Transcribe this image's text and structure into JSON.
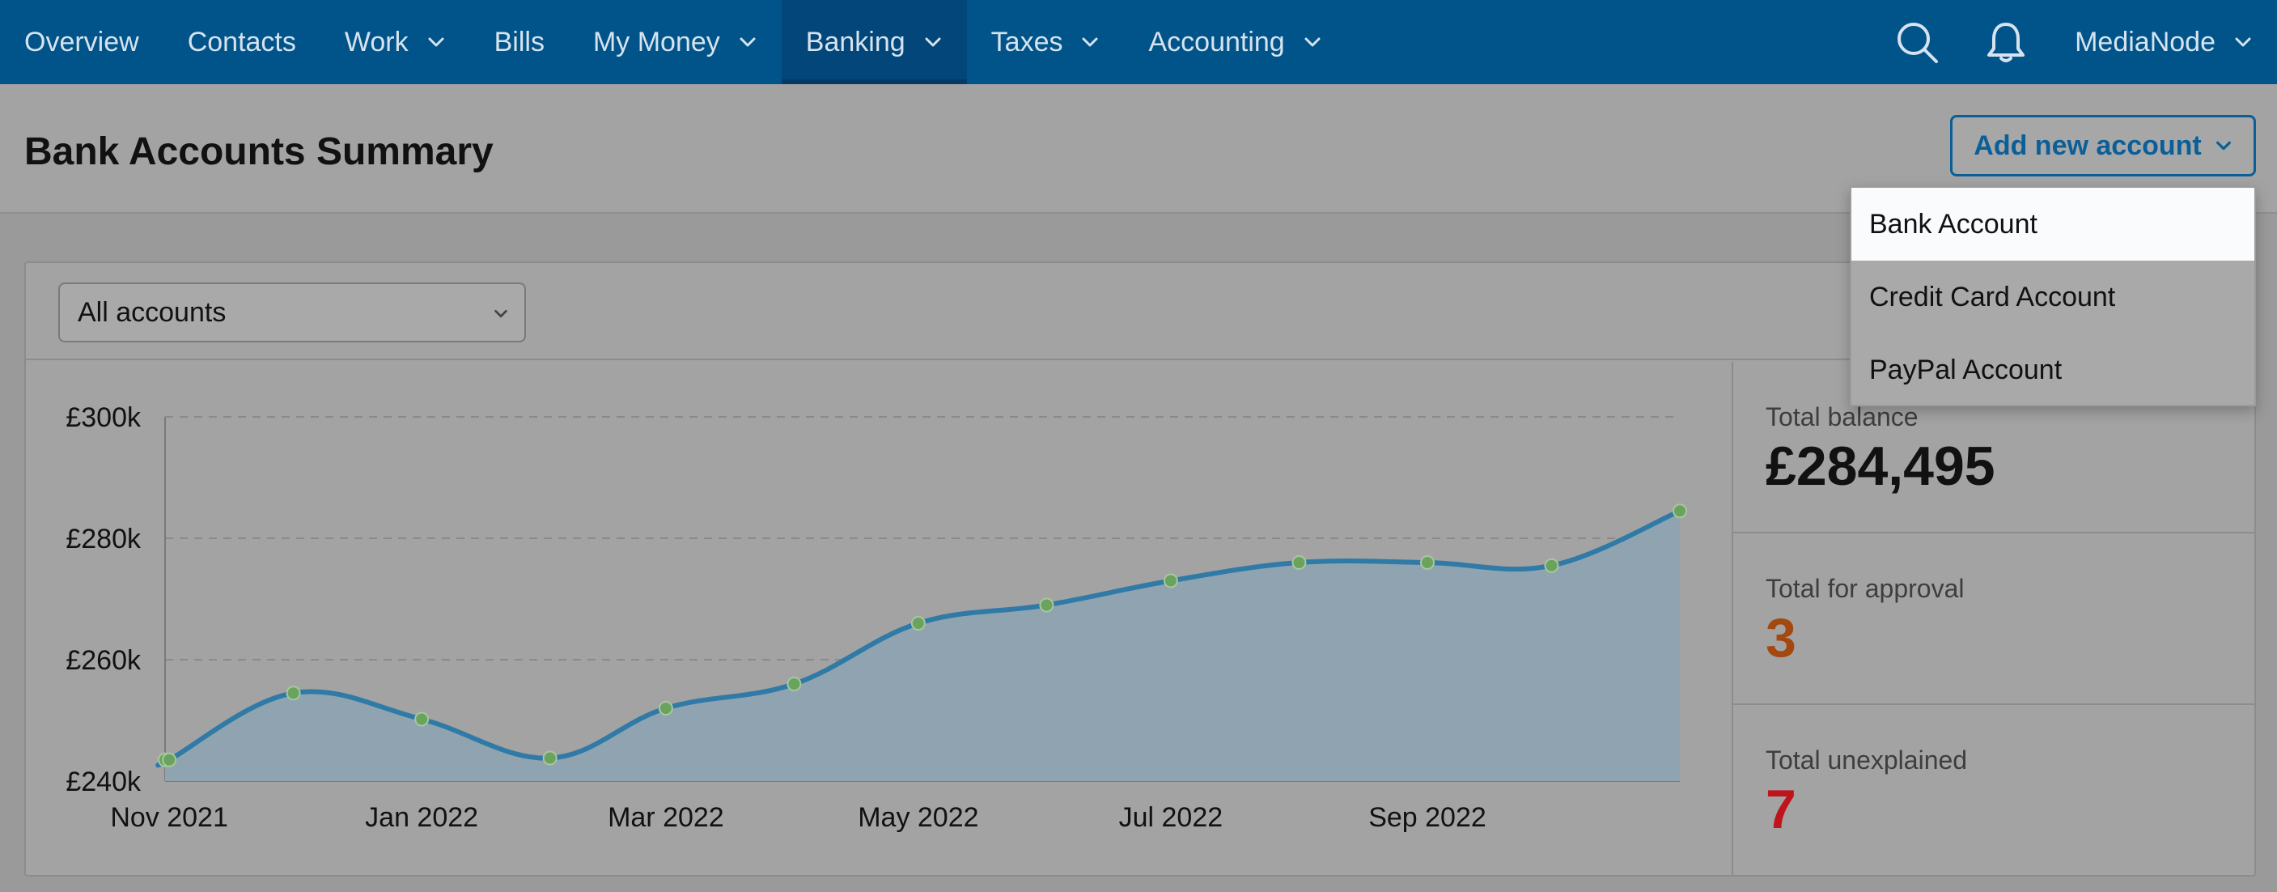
{
  "nav": {
    "items": [
      {
        "label": "Overview",
        "dropdown": false,
        "active": false
      },
      {
        "label": "Contacts",
        "dropdown": false,
        "active": false
      },
      {
        "label": "Work",
        "dropdown": true,
        "active": false
      },
      {
        "label": "Bills",
        "dropdown": false,
        "active": false
      },
      {
        "label": "My Money",
        "dropdown": true,
        "active": false
      },
      {
        "label": "Banking",
        "dropdown": true,
        "active": true
      },
      {
        "label": "Taxes",
        "dropdown": true,
        "active": false
      },
      {
        "label": "Accounting",
        "dropdown": true,
        "active": false
      }
    ],
    "user_label": "MediaNode"
  },
  "header": {
    "title": "Bank Accounts Summary",
    "add_button_label": "Add new account"
  },
  "dropdown": {
    "items": [
      "Bank Account",
      "Credit Card Account",
      "PayPal Account"
    ]
  },
  "filter": {
    "selected": "All accounts"
  },
  "stats": {
    "total_balance": {
      "label": "Total balance",
      "value": "£284,495"
    },
    "total_for_approval": {
      "label": "Total for approval",
      "value": "3"
    },
    "total_unexplained": {
      "label": "Total unexplained",
      "value": "7"
    }
  },
  "colors": {
    "nav_bg": "#00548a",
    "line": "#2f7aa6",
    "area": "#8fa4b0",
    "point": "#6aa35e",
    "approval": "#a3480f",
    "unexplained": "#c0141c",
    "accent": "#0a5f98"
  },
  "chart_data": {
    "type": "area",
    "title": "",
    "xlabel": "",
    "ylabel": "",
    "ylim": [
      240000,
      300000
    ],
    "yticks": [
      {
        "value": 300000,
        "label": "£300k"
      },
      {
        "value": 280000,
        "label": "£280k"
      },
      {
        "value": 260000,
        "label": "£260k"
      },
      {
        "value": 240000,
        "label": "£240k"
      }
    ],
    "xticks": [
      "Nov 2021",
      "Jan 2022",
      "Mar 2022",
      "May 2022",
      "Jul 2022",
      "Sep 2022"
    ],
    "x": [
      "2021-10-31",
      "2021-11-01",
      "2021-12-01",
      "2022-01-01",
      "2022-02-01",
      "2022-03-01",
      "2022-04-01",
      "2022-05-01",
      "2022-06-01",
      "2022-07-01",
      "2022-08-01",
      "2022-09-01",
      "2022-10-01",
      "2022-11-01"
    ],
    "series": [
      {
        "values": [
          243500,
          243500,
          254500,
          250200,
          243800,
          252000,
          256000,
          266000,
          269000,
          273000,
          276000,
          276000,
          275500,
          284500
        ]
      }
    ],
    "grid": true
  }
}
